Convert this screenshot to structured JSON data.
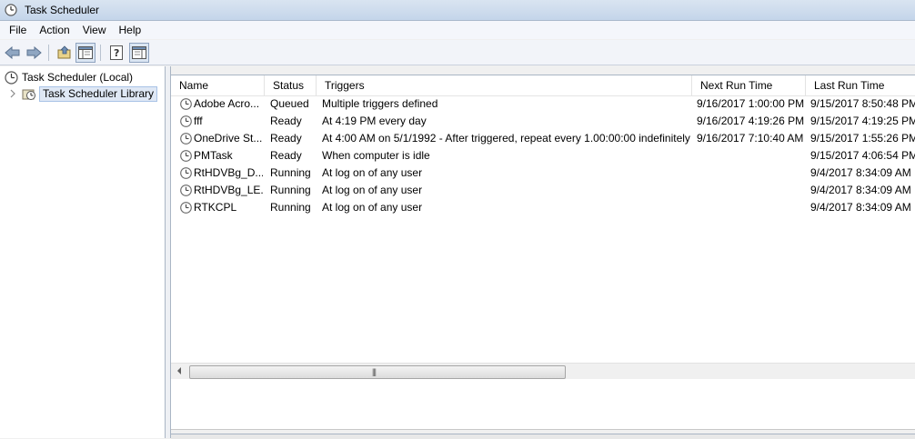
{
  "window": {
    "title": "Task Scheduler"
  },
  "menu": [
    "File",
    "Action",
    "View",
    "Help"
  ],
  "toolbar": {
    "buttons": [
      "back-arrow-icon",
      "forward-arrow-icon",
      "up-folder-icon",
      "show-hide-console-tree-icon",
      "help-icon",
      "show-hide-action-pane-icon"
    ]
  },
  "tree": {
    "root": "Task Scheduler (Local)",
    "library": "Task Scheduler Library"
  },
  "columns": [
    "Name",
    "Status",
    "Triggers",
    "Next Run Time",
    "Last Run Time"
  ],
  "tasks": [
    {
      "name": "Adobe Acro...",
      "status": "Queued",
      "triggers": "Multiple triggers defined",
      "next": "9/16/2017 1:00:00 PM",
      "last": "9/15/2017 8:50:48 PM"
    },
    {
      "name": "fff",
      "status": "Ready",
      "triggers": "At 4:19 PM every day",
      "next": "9/16/2017 4:19:26 PM",
      "last": "9/15/2017 4:19:25 PM"
    },
    {
      "name": "OneDrive St...",
      "status": "Ready",
      "triggers": "At 4:00 AM on 5/1/1992 - After triggered, repeat every 1.00:00:00 indefinitely.",
      "next": "9/16/2017 7:10:40 AM",
      "last": "9/15/2017 1:55:26 PM"
    },
    {
      "name": "PMTask",
      "status": "Ready",
      "triggers": "When computer is idle",
      "next": "",
      "last": "9/15/2017 4:06:54 PM"
    },
    {
      "name": "RtHDVBg_D...",
      "status": "Running",
      "triggers": "At log on of any user",
      "next": "",
      "last": "9/4/2017 8:34:09 AM"
    },
    {
      "name": "RtHDVBg_LE...",
      "status": "Running",
      "triggers": "At log on of any user",
      "next": "",
      "last": "9/4/2017 8:34:09 AM"
    },
    {
      "name": "RTKCPL",
      "status": "Running",
      "triggers": "At log on of any user",
      "next": "",
      "last": "9/4/2017 8:34:09 AM"
    }
  ],
  "scrollbar": {
    "grip": "|||"
  }
}
